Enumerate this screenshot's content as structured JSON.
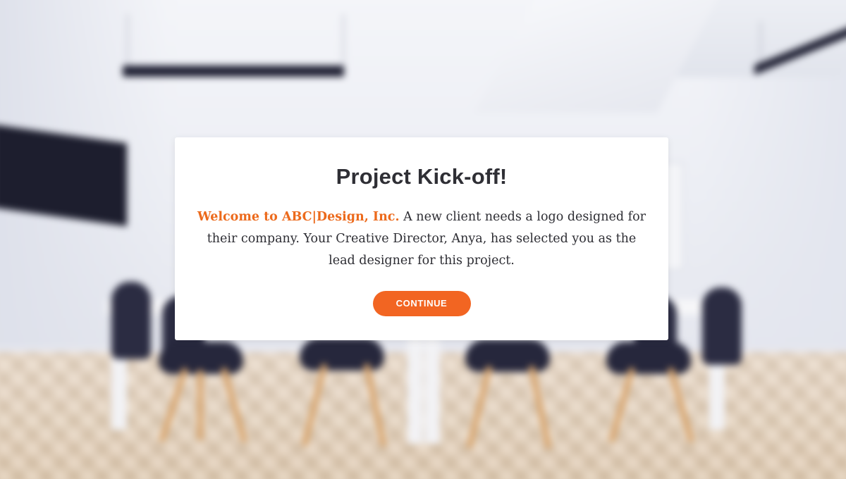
{
  "modal": {
    "title": "Project Kick-off!",
    "body_highlight": "Welcome to ABC|Design, Inc.",
    "body_text": " A new client needs a logo designed for their company.  Your Creative Director, Anya, has selected you as the lead designer for this project.",
    "continue_label": "CONTINUE"
  },
  "colors": {
    "accent": "#f26522",
    "highlight_text": "#ec6a1c",
    "title_text": "#2f2f35",
    "card_background": "#ffffff"
  }
}
